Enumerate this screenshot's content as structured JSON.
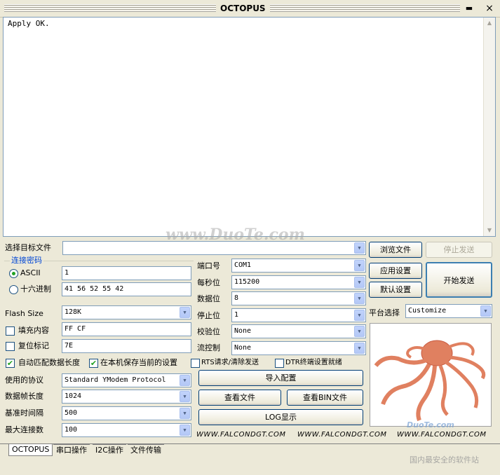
{
  "window": {
    "title": "OCTOPUS",
    "minimize": "▬",
    "close": "×"
  },
  "console": {
    "text": "Apply OK."
  },
  "target_file": {
    "label": "选择目标文件",
    "value": ""
  },
  "password_group": {
    "title": "连接密码",
    "ascii_label": "ASCII",
    "ascii_value": "1",
    "ascii_selected": true,
    "hex_label": "十六进制",
    "hex_value": "41 56 52 55 42"
  },
  "flash": {
    "label": "Flash Size",
    "value": "128K"
  },
  "fill": {
    "label": "填充内容",
    "value": "FF CF",
    "checked": false
  },
  "reset": {
    "label": "复位标记",
    "value": "7E",
    "checked": false
  },
  "options": {
    "auto_match_label": "自动匹配数据长度",
    "auto_match_checked": true,
    "save_local_label": "在本机保存当前的设置",
    "save_local_checked": true,
    "rts_label": "RTS请求/清除发送",
    "rts_checked": false,
    "dtr_label": "DTR终端设置就绪",
    "dtr_checked": false
  },
  "protocol": {
    "label": "使用的协议",
    "value": "Standard YModem Protocol"
  },
  "packet_len": {
    "label": "数据帧长度",
    "value": "1024"
  },
  "base_time": {
    "label": "基准时间隔",
    "value": "500"
  },
  "max_conn": {
    "label": "最大连接数",
    "value": "100"
  },
  "serial": {
    "port_label": "端口号",
    "port_value": "COM1",
    "baud_label": "每秒位",
    "baud_value": "115200",
    "data_label": "数据位",
    "data_value": "8",
    "stop_label": "停止位",
    "stop_value": "1",
    "parity_label": "校验位",
    "parity_value": "None",
    "flow_label": "流控制",
    "flow_value": "None"
  },
  "buttons": {
    "browse": "浏览文件",
    "stop_send": "停止发送",
    "apply": "应用设置",
    "start_send": "开始发送",
    "default": "默认设置",
    "import_cfg": "导入配置",
    "view_file": "查看文件",
    "view_bin": "查看BIN文件",
    "log_show": "LOG显示"
  },
  "platform": {
    "label": "平台选择",
    "value": "Customize"
  },
  "footer": {
    "url1": "WWW.FALCONDGT.COM",
    "url2": "WWW.FALCONDGT.COM",
    "url3": "WWW.FALCONDGT.COM"
  },
  "tabs": [
    {
      "label": "OCTOPUS",
      "active": true
    },
    {
      "label": "串口操作",
      "active": false
    },
    {
      "label": "I2C操作",
      "active": false
    },
    {
      "label": "文件传输",
      "active": false
    }
  ],
  "watermarks": {
    "center": "www.DuoTe.com",
    "corner_brand": "DuoTe.com",
    "corner_caption": "国内最安全的软件站"
  },
  "icons": {
    "dropdown": "▼",
    "scroll_up": "▲",
    "scroll_down": "▼",
    "check": "✔"
  },
  "colors": {
    "check_green": "#21a121",
    "input_border": "#7f9db9",
    "window_bg": "#ece9d8",
    "group_title": "#0046d5"
  }
}
